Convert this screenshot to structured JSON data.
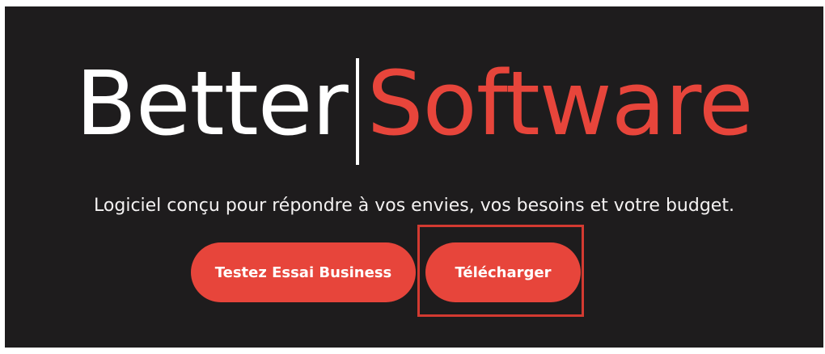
{
  "hero": {
    "logo": {
      "left": "Better",
      "right": "Software"
    },
    "tagline": "Logiciel conçu pour répondre à vos envies, vos besoins et votre budget.",
    "buttons": {
      "trial": "Testez Essai Business",
      "download": "Télécharger"
    },
    "colors": {
      "background": "#1e1c1d",
      "accent": "#e7453b",
      "text": "#ffffff"
    }
  }
}
